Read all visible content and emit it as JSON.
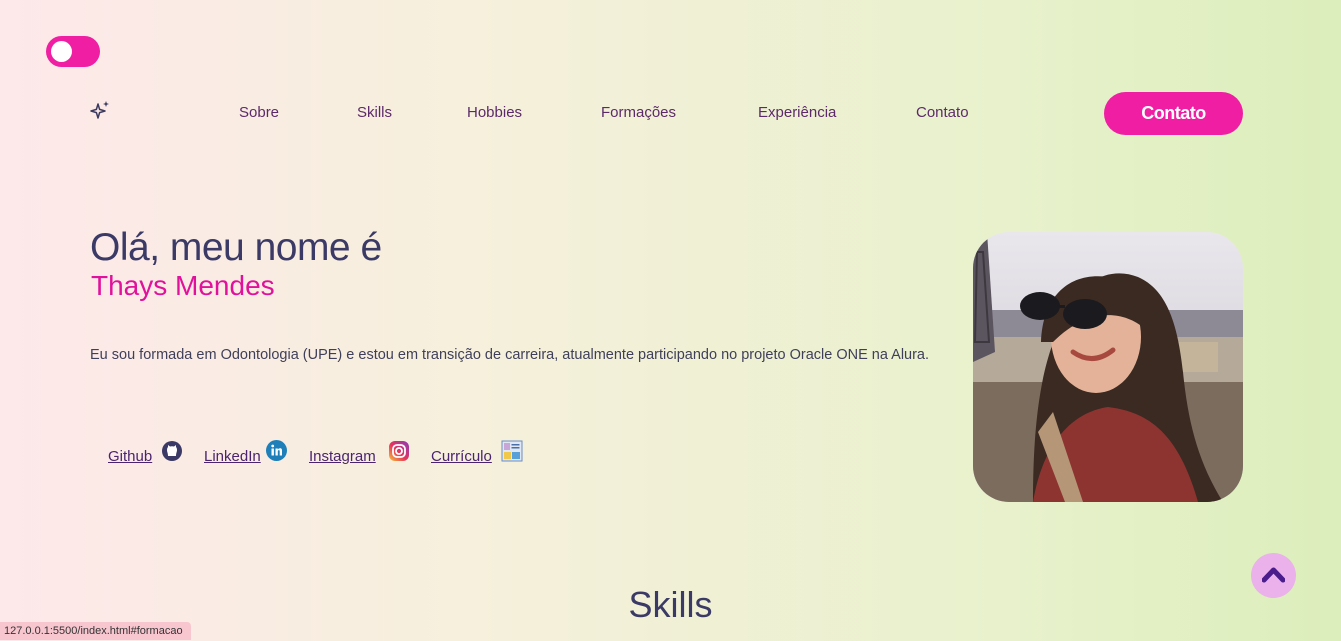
{
  "theme": {
    "accent": "#ef1ea2",
    "text": "#3b3a66",
    "name_color": "#e0129c"
  },
  "toggle": {
    "icon": "theme-toggle-switch"
  },
  "logo": {
    "icon": "sparkles-icon"
  },
  "nav": {
    "items": [
      {
        "label": "Sobre"
      },
      {
        "label": "Skills"
      },
      {
        "label": "Hobbies"
      },
      {
        "label": "Formações"
      },
      {
        "label": "Experiência"
      },
      {
        "label": "Contato"
      }
    ],
    "cta_label": "Contato"
  },
  "hero": {
    "greeting": "Olá, meu nome é",
    "name": "Thays Mendes",
    "bio": "Eu sou formada em Odontologia (UPE) e estou em transição de carreira, atualmente participando no projeto Oracle ONE na Alura."
  },
  "links": [
    {
      "label": "Github",
      "icon": "github-icon"
    },
    {
      "label": "LinkedIn",
      "icon": "linkedin-icon"
    },
    {
      "label": "Instagram",
      "icon": "instagram-icon"
    },
    {
      "label": "Currículo",
      "icon": "resume-icon"
    }
  ],
  "photo": {
    "icon": "profile-photo"
  },
  "scroll_top": {
    "icon": "chevron-up-icon"
  },
  "skills": {
    "title": "Skills"
  },
  "status_bar": {
    "url": "127.0.0.1:5500/index.html#formacao"
  }
}
